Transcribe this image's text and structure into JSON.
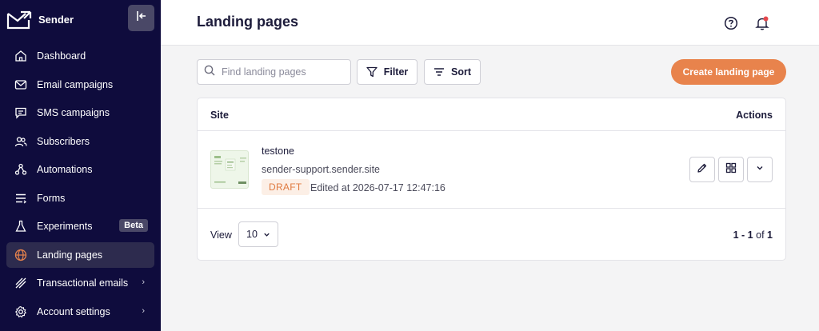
{
  "brand": {
    "name": "Sender"
  },
  "sidebar": {
    "items": [
      {
        "label": "Dashboard",
        "icon": "home-icon"
      },
      {
        "label": "Email campaigns",
        "icon": "mail-icon"
      },
      {
        "label": "SMS campaigns",
        "icon": "chat-icon"
      },
      {
        "label": "Subscribers",
        "icon": "users-icon"
      },
      {
        "label": "Automations",
        "icon": "workflow-icon"
      },
      {
        "label": "Forms",
        "icon": "forms-icon"
      },
      {
        "label": "Experiments",
        "icon": "flask-icon",
        "badge": "Beta"
      },
      {
        "label": "Landing pages",
        "icon": "globe-icon",
        "active": true
      },
      {
        "label": "Transactional emails",
        "icon": "bolt-icon",
        "chevron": "›"
      },
      {
        "label": "Account settings",
        "icon": "gear-icon",
        "chevron": "›"
      }
    ]
  },
  "header": {
    "title": "Landing pages"
  },
  "toolbar": {
    "search_placeholder": "Find landing pages",
    "filter_label": "Filter",
    "sort_label": "Sort",
    "create_label": "Create landing page"
  },
  "table": {
    "col_site": "Site",
    "col_actions": "Actions",
    "row": {
      "name": "testone",
      "url": "sender-support.sender.site",
      "status": "DRAFT",
      "edited": "Edited at 2026-07-17 12:47:16"
    },
    "footer": {
      "view_label": "View",
      "view_value": "10",
      "range": "1 - 1",
      "of": "of",
      "total": "1"
    }
  },
  "colors": {
    "sidebar_bg": "#0f0c3d",
    "accent": "#e8834c",
    "draft_text": "#e07a3f",
    "notification_dot": "#e5484d"
  }
}
